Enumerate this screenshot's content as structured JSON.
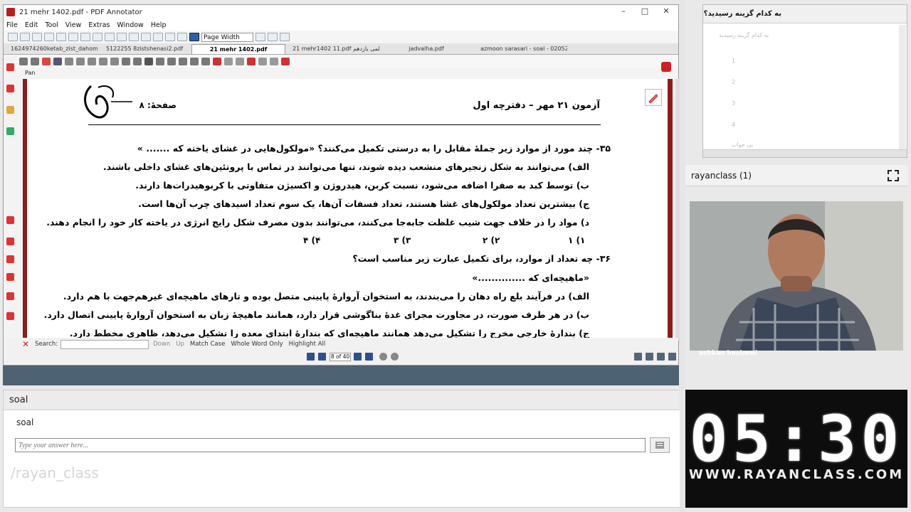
{
  "pdf_window": {
    "title": "21 mehr 1402.pdf - PDF Annotator",
    "menu": [
      "File",
      "Edit",
      "Tool",
      "View",
      "Extras",
      "Window",
      "Help"
    ],
    "zoom_mode": "Page Width",
    "tabs": [
      "1624974260ketab_zist_dahom140...*",
      "5122255 8zistshenasi2.pdf",
      "21 mehr 1402.pdf",
      "21 mehr1402 11.pdf علمی یازدهم",
      "jadvalha.pdf",
      "azmoon sarasari - soal - 020524.pdf"
    ],
    "active_tab": 2,
    "tool_label": "Pan",
    "search": {
      "label": "Search:",
      "down": "Down",
      "up": "Up",
      "match_case": "Match Case",
      "whole_word": "Whole Word Only",
      "highlight_all": "Highlight All"
    },
    "page_indicator": "8 of 40"
  },
  "document": {
    "exam_title": "آزمون ۲۱ مهر – دفترچه اول",
    "page_number": "صفحهٔ: ۸",
    "q35": {
      "stem": "۳۵- چند مورد از موارد زیر جملهٔ مقابل را به درستی تکمیل می‌کنند؟ «مولکول‌هایی در غشای یاخته که ....... »",
      "a": "الف) می‌توانند به شکل زنجیرهای منشعب دیده شوند، تنها می‌توانند در تماس با پروتئین‌های غشای داخلی باشند.",
      "b": "ب) توسط کبد به صفرا اضافه می‌شود، نسبت کربن، هیدروژن و اکسیژن متفاوتی با کربوهیدرات‌ها دارند.",
      "c": "ج) بیشترین تعداد مولکول‌های غشا هستند، تعداد فسفات آن‌ها، یک سوم تعداد اسیدهای چرب آن‌ها است.",
      "d": "د) مواد را در خلاف جهت شیب غلظت جابه‌جا می‌کنند، می‌توانند بدون مصرف شکل رایج انرژی در یاخته کار خود را انجام دهند.",
      "options": [
        "۱) ۱",
        "۲) ۲",
        "۳) ۳",
        "۴) ۴"
      ]
    },
    "q36": {
      "stem": "۳۶- چه تعداد از موارد، برای تکمیل عبارت زیر مناسب است؟",
      "quote": "«ماهیچه‌ای که ..............»",
      "a": "الف) در فرآیند بلع راه دهان را می‌بندند، به استخوان آروارهٔ پایینی متصل بوده و تارهای ماهیچه‌ای غیرهم‌جهت با هم دارد.",
      "b": "ب) در هر طرف صورت، در مجاورت مجرای غدهٔ بناگوشی قرار دارد، همانند ماهیچهٔ زبان به استخوان آروارهٔ پایینی اتصال دارد.",
      "c": "ج) بندارهٔ خارجی مخرج را تشکیل می‌دهد همانند ماهیچه‌ای که بندارهٔ ابتدای معده را تشکیل می‌دهد، ظاهری مخطط دارد."
    }
  },
  "question_panel": {
    "header": "soal",
    "label": "soal",
    "placeholder": "Type your answer here...",
    "watermark": "/rayan_class"
  },
  "poll": {
    "title": "به کدام گزینه رسیدید؟",
    "question": "به کدام گزینه رسیدید",
    "options": [
      "1",
      "2",
      "3",
      "4",
      "بی جواب"
    ]
  },
  "video": {
    "room": "rayanclass",
    "count": "(1)",
    "presenter": "ashkan hashemi"
  },
  "timer": {
    "time": "05:30",
    "url": "WWW.RAYANCLASS.COM"
  }
}
